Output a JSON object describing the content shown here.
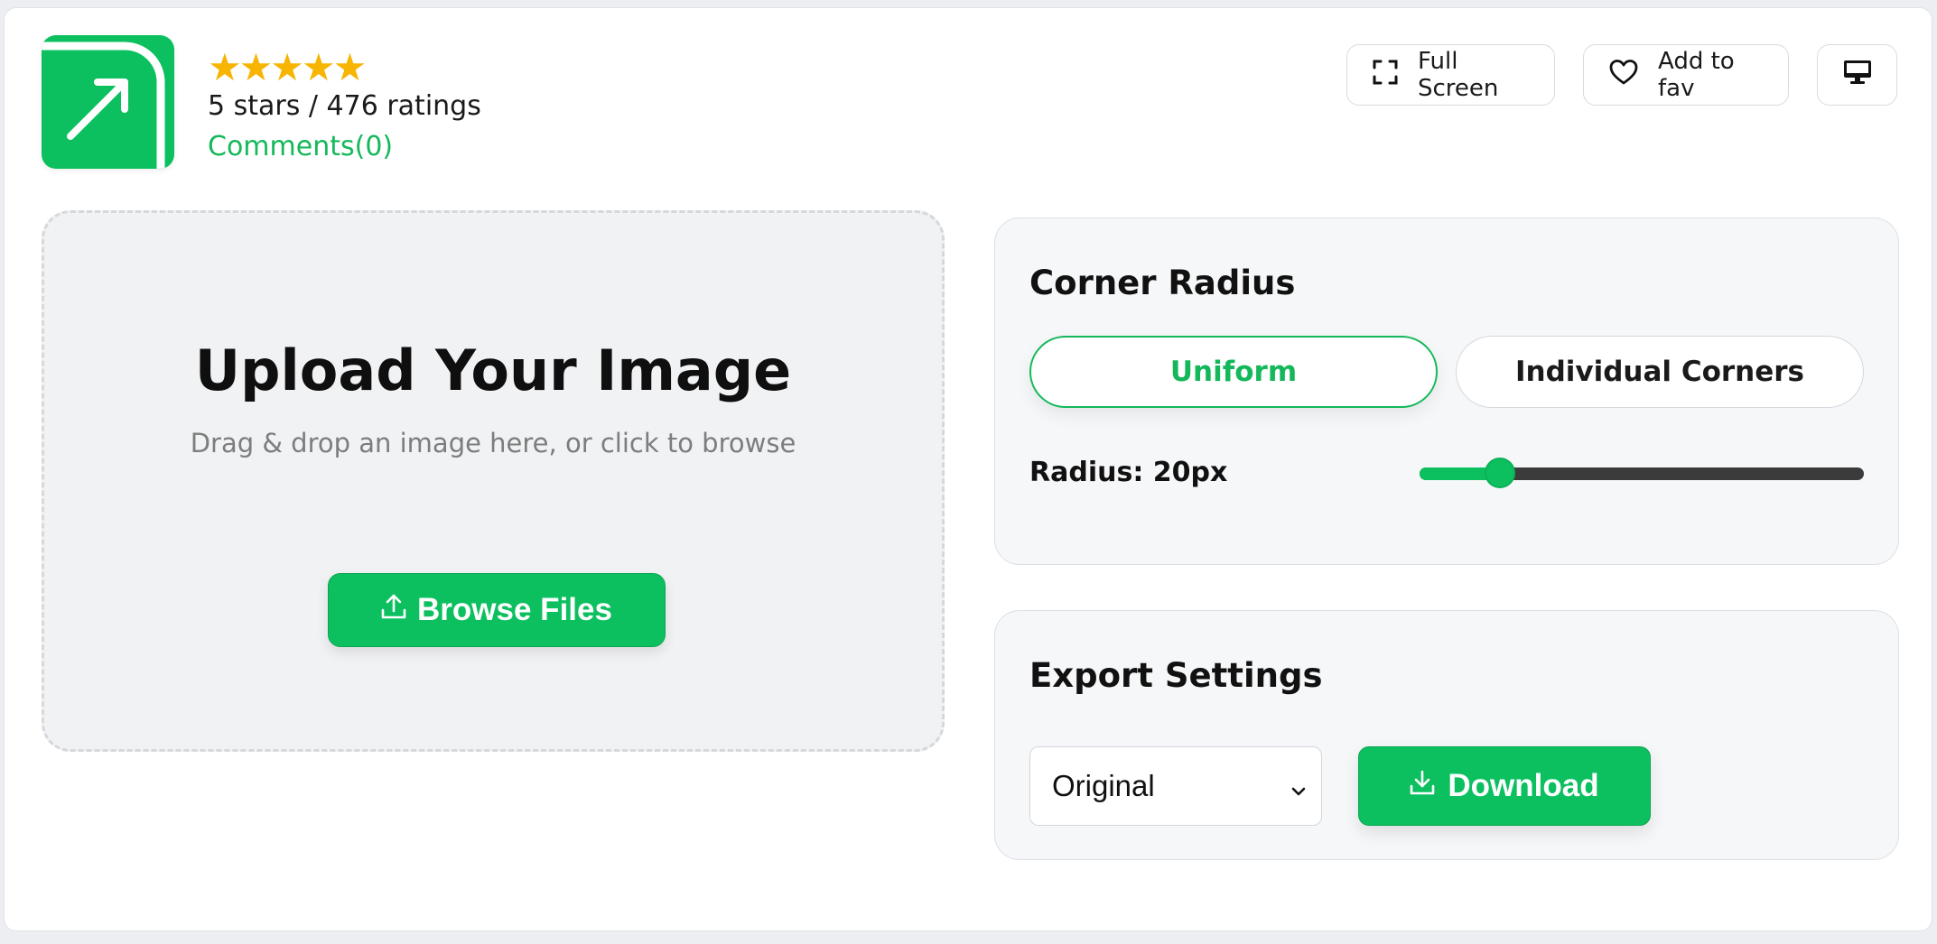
{
  "header": {
    "stars": "★★★★★",
    "rating_text": "5 stars / 476 ratings",
    "comments_label": "Comments(0)",
    "fullscreen_label": "Full Screen",
    "fav_label": "Add to fav"
  },
  "upload": {
    "title": "Upload Your Image",
    "subtitle": "Drag & drop an image here, or click to browse",
    "browse_label": "Browse Files"
  },
  "corner_radius": {
    "title": "Corner Radius",
    "mode_uniform": "Uniform",
    "mode_individual": "Individual Corners",
    "selected_mode": "Uniform",
    "radius_label": "Radius: 20px",
    "slider_fraction": 0.18
  },
  "export": {
    "title": "Export Settings",
    "format_value": "Original",
    "download_label": "Download"
  },
  "colors": {
    "accent": "#0cc05f",
    "star": "#f7b500",
    "link": "#15b85a"
  },
  "icons": {
    "app": "arrow-up-right-icon",
    "fullscreen": "fullscreen-icon",
    "fav": "heart-icon",
    "desktop": "monitor-icon",
    "upload": "upload-icon",
    "download": "download-icon",
    "select": "chevron-down-icon"
  }
}
